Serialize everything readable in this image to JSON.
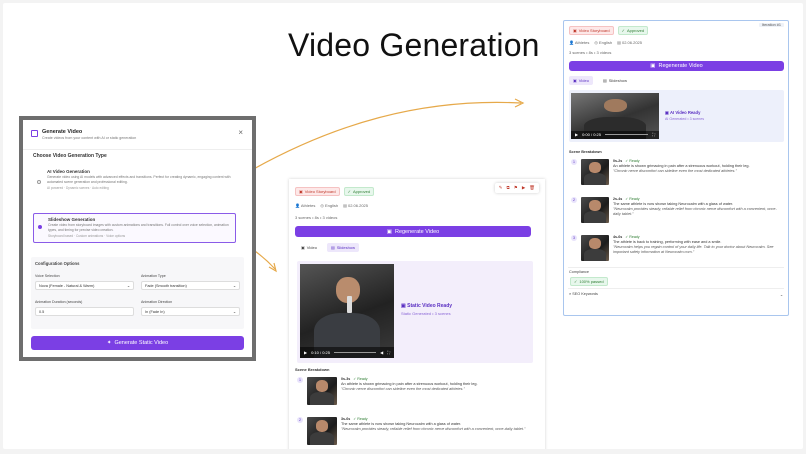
{
  "page": {
    "title": "Video Generation"
  },
  "modal": {
    "title": "Generate Video",
    "subtitle": "Create videos from your content with AI or static generation",
    "section_label": "Choose Video Generation Type",
    "options": [
      {
        "title": "AI Video Generation",
        "desc": "Generate video using AI models with advanced effects and transitions. Perfect for creating dynamic, engaging content with automated scene generation and professional editing.",
        "meta": "AI powered  ·  Dynamic scenes  ·  Auto editing",
        "selected": false
      },
      {
        "title": "Slideshow Generation",
        "desc": "Create video from storyboard images with custom animations and transitions. Full control over voice selection, animation types, and timing for precise video creation.",
        "meta": "Storyboard based  ·  Custom animations  ·  Voice options",
        "selected": true
      }
    ],
    "config": {
      "title": "Configuration Options",
      "voice_label": "Voice Selection",
      "voice_value": "Nova (Female - Natural & Warm)",
      "anim_type_label": "Animation Type",
      "anim_type_value": "Fade (Smooth transition)",
      "duration_label": "Animation Duration (seconds)",
      "duration_value": "0.5",
      "direction_label": "Animation Direction",
      "direction_value": "In (Fade In)"
    },
    "generate_button": "Generate Static Video"
  },
  "middle": {
    "badges": {
      "type": "Video Storyboard",
      "status": "Approved"
    },
    "meta": {
      "category": "Athletes",
      "language": "English",
      "date": "02.06.2025"
    },
    "summary": "3 scenes • 8s • 3 videos",
    "regen_button": "Regenerate Video",
    "tabs": [
      "Video",
      "Slideshow"
    ],
    "player_time": "0:10 / 0:25",
    "ready_title": "Static Video Ready",
    "ready_sub": "Static Generated • 3 scenes",
    "breakdown_label": "Scene Breakdown",
    "scenes": [
      {
        "num": "1",
        "time": "0s-3s",
        "status": "Ready",
        "text": "An athlete is shown grimacing in pain after a strenuous workout, holding their leg.",
        "quote": "\"Chronic nerve discomfort can sideline even the most dedicated athletes.\""
      },
      {
        "num": "2",
        "time": "3s-6s",
        "status": "Ready",
        "text": "The same athlete is now shown taking Neurocalm with a glass of water.",
        "quote": "\"Neurocalm provides steady, reliable relief from chronic nerve discomfort with a convenient, once-daily tablet.\""
      }
    ]
  },
  "right": {
    "iteration": "Iteration #1",
    "badges": {
      "type": "Video Storyboard",
      "status": "Approved"
    },
    "meta": {
      "category": "Athletes",
      "language": "English",
      "date": "02.06.2025"
    },
    "summary": "3 scenes • 8s • 3 videos",
    "regen_button": "Regenerate Video",
    "tabs": [
      "Video",
      "Slideshow"
    ],
    "player_time": "0:00 / 0:25",
    "ready_title": "AI Video Ready",
    "ready_sub": "AI Generated • 3 scenes",
    "breakdown_label": "Scene Breakdown",
    "scenes": [
      {
        "num": "1",
        "time": "0s-2s",
        "status": "Ready",
        "text": "An athlete is shown grimacing in pain after a strenuous workout, holding their leg.",
        "quote": "\"Chronic nerve discomfort can sideline even the most dedicated athletes.\""
      },
      {
        "num": "2",
        "time": "2s-4s",
        "status": "Ready",
        "text": "The same athlete is now shown taking Neurocalm with a glass of water.",
        "quote": "\"Neurocalm provides steady, reliable relief from chronic nerve discomfort with a convenient, once-daily tablet.\""
      },
      {
        "num": "3",
        "time": "4s-6s",
        "status": "Ready",
        "text": "The athlete is back to training, performing with ease and a smile.",
        "quote": "\"Neurocalm helps you regain control of your daily life. Talk to your doctor about Neurocalm. See important safety information at Neurocalm.com.\""
      }
    ],
    "compliance_label": "Compliance",
    "compliance_value": "100% passed",
    "seo_label": "SEO Keywords"
  },
  "colors": {
    "accent": "#7b3fe4",
    "approved": "#2e7d32",
    "storyboard": "#c0392b",
    "arrow": "#e6a94a"
  }
}
